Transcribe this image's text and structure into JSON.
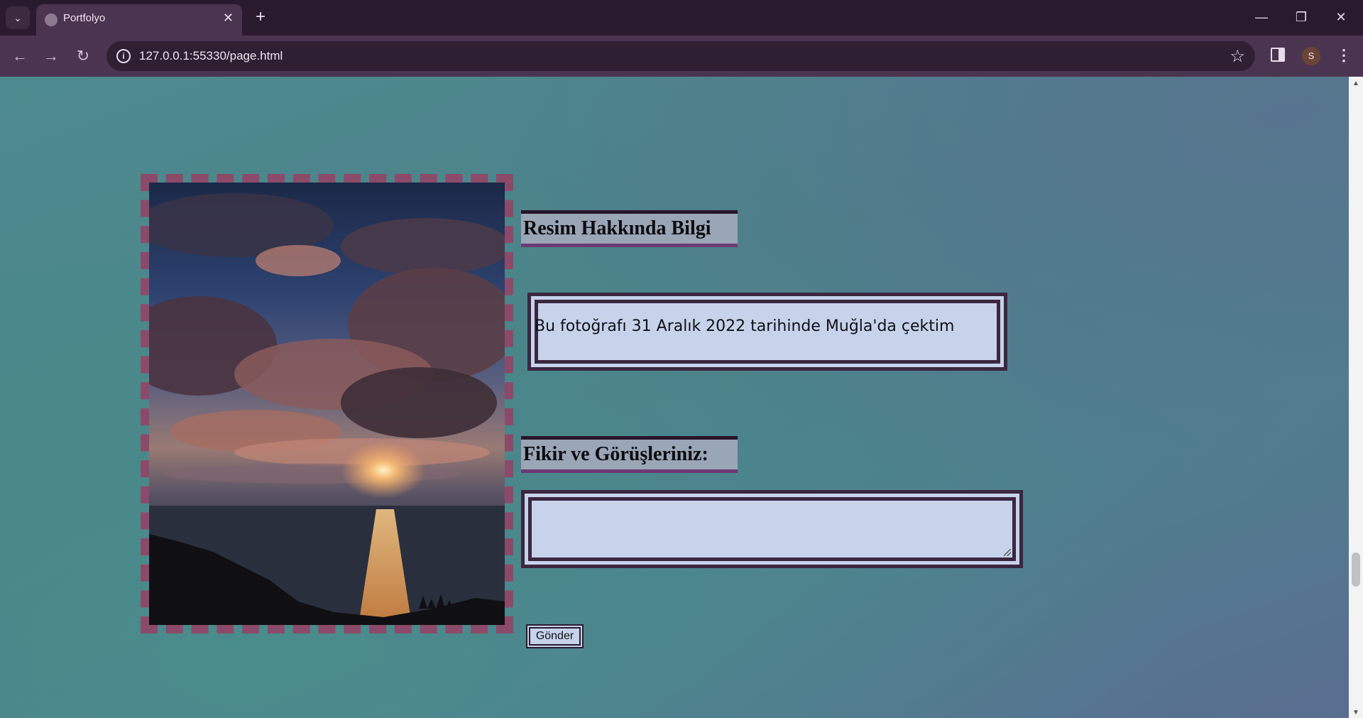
{
  "browser": {
    "tab_title": "Portfolyo",
    "url": "127.0.0.1:55330/page.html",
    "profile_initial": "S"
  },
  "icons": {
    "tab_menu": "chevron-down-icon",
    "tab_close": "close-icon",
    "new_tab": "plus-icon",
    "back": "arrow-left-icon",
    "forward": "arrow-right-icon",
    "reload": "reload-icon",
    "site_info": "info-icon",
    "bookmark": "star-icon",
    "side_panel": "side-panel-icon",
    "menu": "kebab-icon"
  },
  "page": {
    "info_heading": "Resim Hakkında Bilgi",
    "info_text": "Bu fotoğrafı 31 Aralık 2022 tarihinde Muğla'da çektim",
    "comment_heading": "Fikir ve Görüşleriniz:",
    "comment_value": "",
    "submit_label": "Gönder"
  },
  "colors": {
    "frame_dash": "#8c4a6a",
    "panel_bg": "#c6d3ea",
    "heading_bg": "#9aa5b6",
    "border_dark": "#3b2640"
  }
}
